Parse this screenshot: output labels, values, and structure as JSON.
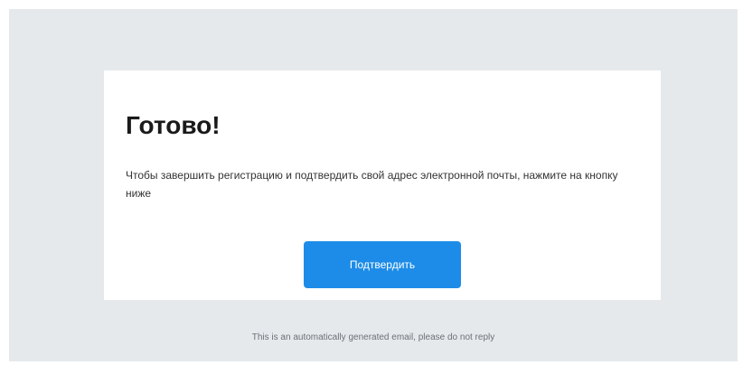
{
  "card": {
    "heading": "Готово!",
    "body": "Чтобы завершить регистрацию и подтвердить свой адрес электронной почты, нажмите на кнопку ниже",
    "button_label": "Подтвердить"
  },
  "footer": {
    "note": "This is an automatically generated email, please do not reply"
  },
  "colors": {
    "background": "#e6e9ec",
    "card": "#ffffff",
    "accent": "#1d8ce8"
  }
}
